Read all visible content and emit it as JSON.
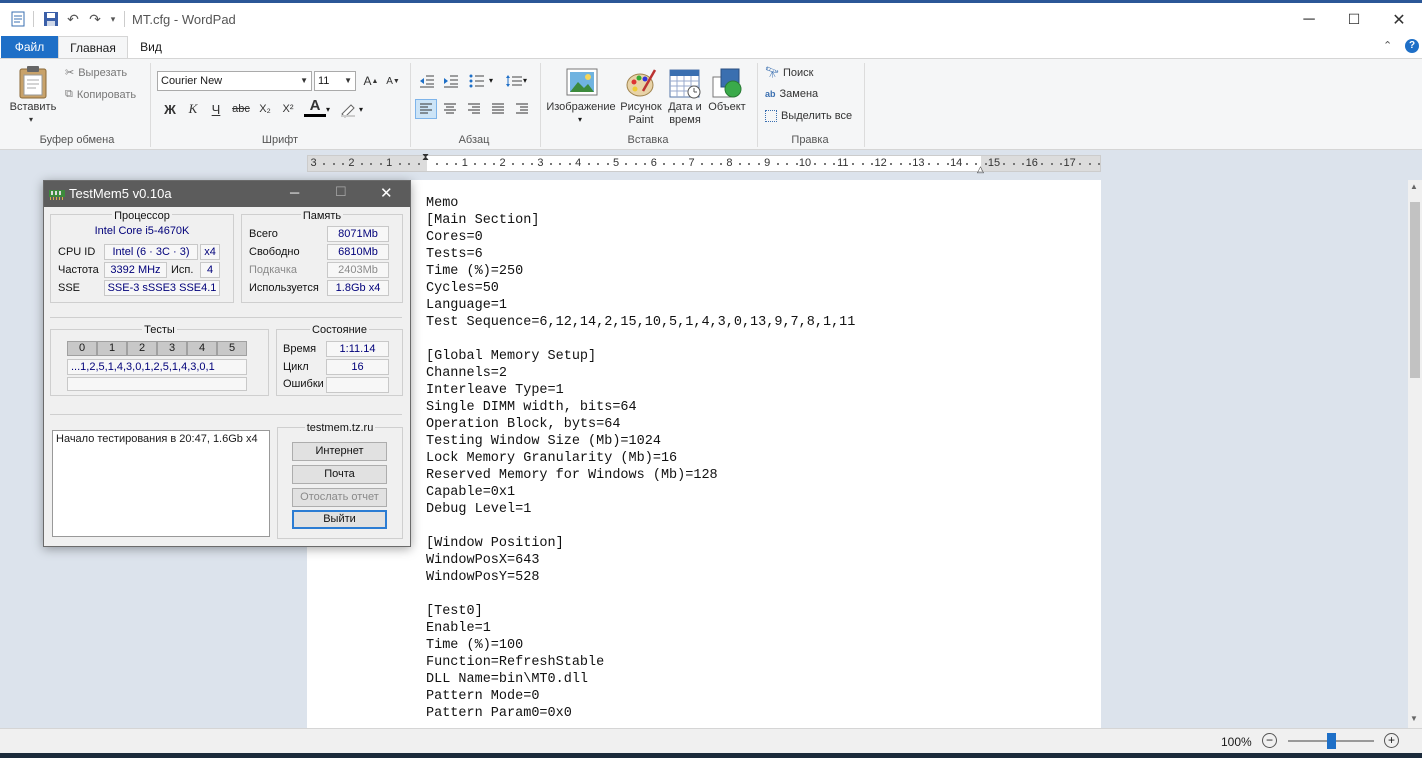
{
  "window": {
    "title": "MT.cfg - WordPad",
    "minimize": "─",
    "maximize": "☐",
    "close": "✕"
  },
  "ribbon_tabs": {
    "file": "Файл",
    "home": "Главная",
    "view": "Вид"
  },
  "clipboard": {
    "paste": "Вставить",
    "cut": "Вырезать",
    "copy": "Копировать",
    "group": "Буфер обмена"
  },
  "font": {
    "family": "Courier New",
    "size": "11",
    "group": "Шрифт",
    "bold": "Ж",
    "italic": "К",
    "underline": "Ч",
    "strike": "abc",
    "subscript": "X₂",
    "superscript": "X²",
    "color_glyph": "A"
  },
  "paragraph": {
    "group": "Абзац"
  },
  "insert": {
    "group": "Вставка",
    "picture": "Изображение",
    "paint": "Рисунок Paint",
    "datetime": "Дата и время",
    "object": "Объект"
  },
  "editing": {
    "group": "Правка",
    "find": "Поиск",
    "replace": "Замена",
    "select_all": "Выделить все"
  },
  "ruler": [
    "3",
    "2",
    "1",
    "1",
    "2",
    "3",
    "4",
    "5",
    "6",
    "7",
    "8",
    "9",
    "10",
    "11",
    "12",
    "13",
    "14",
    "15",
    "16",
    "17"
  ],
  "document": {
    "lines": [
      "Memo",
      "[Main Section]",
      "Cores=0",
      "Tests=6",
      "Time (%)=250",
      "Cycles=50",
      "Language=1",
      "Test Sequence=6,12,14,2,15,10,5,1,4,3,0,13,9,7,8,1,11",
      "",
      "[Global Memory Setup]",
      "Channels=2",
      "Interleave Type=1",
      "Single DIMM width, bits=64",
      "Operation Block, byts=64",
      "Testing Window Size (Mb)=1024",
      "Lock Memory Granularity (Mb)=16",
      "Reserved Memory for Windows (Mb)=128",
      "Capable=0x1",
      "Debug Level=1",
      "",
      "[Window Position]",
      "WindowPosX=643",
      "WindowPosY=528",
      "",
      "[Test0]",
      "Enable=1",
      "Time (%)=100",
      "Function=RefreshStable",
      "DLL Name=bin\\MT0.dll",
      "Pattern Mode=0",
      "Pattern Param0=0x0"
    ]
  },
  "status": {
    "zoom": "100%",
    "zoom_level": 0.5
  },
  "testmem": {
    "title": "TestMem5 v0.10a",
    "cpu": {
      "group": "Процессор",
      "model": "Intel Core i5-4670K",
      "id_label": "CPU ID",
      "id_value": "Intel (6 · 3C · 3)",
      "threads": "x4",
      "freq_label": "Частота",
      "freq_value": "3392 MHz",
      "used_label": "Исп.",
      "used_value": "4",
      "sse_label": "SSE",
      "sse_value": "SSE-3 sSSE3 SSE4.1"
    },
    "memory": {
      "group": "Память",
      "total_label": "Всего",
      "total_value": "8071Mb",
      "free_label": "Свободно",
      "free_value": "6810Mb",
      "swap_label": "Подкачка",
      "swap_value": "2403Mb",
      "used_label": "Используется",
      "used_value": "1.8Gb x4"
    },
    "tests": {
      "group": "Тесты",
      "headers": [
        "0",
        "1",
        "2",
        "3",
        "4",
        "5"
      ],
      "sequence": "...1,2,5,1,4,3,0,1,2,5,1,4,3,0,1"
    },
    "state": {
      "group": "Состояние",
      "time_label": "Время",
      "time_value": "1:11.14",
      "cycle_label": "Цикл",
      "cycle_value": "16",
      "errors_label": "Ошибки",
      "errors_value": ""
    },
    "log": "Начало тестирования в 20:47, 1.6Gb x4",
    "site": "testmem.tz.ru",
    "buttons": {
      "internet": "Интернет",
      "mail": "Почта",
      "report": "Отослать отчет",
      "exit": "Выйти"
    }
  }
}
